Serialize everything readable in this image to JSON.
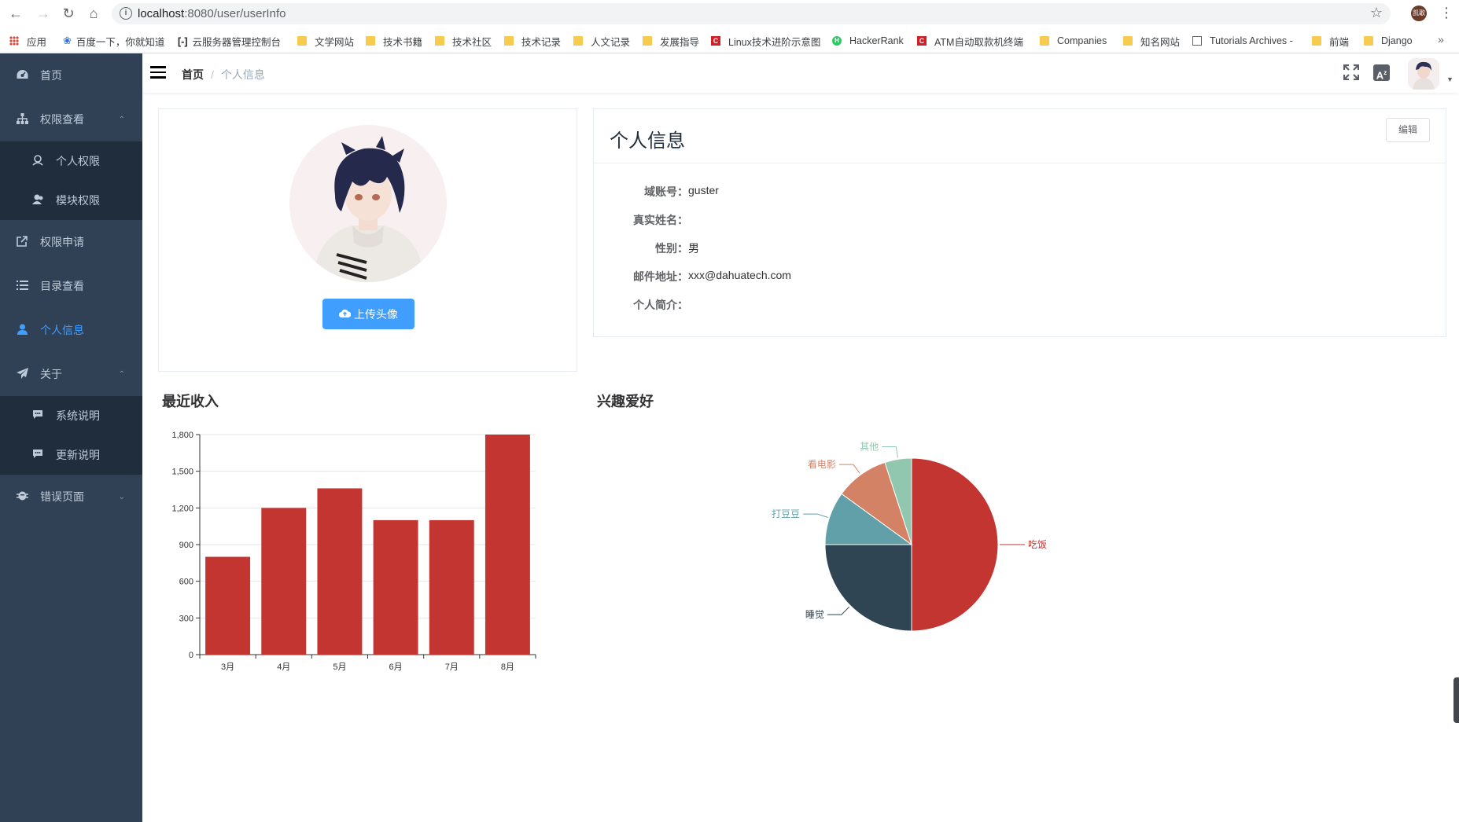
{
  "browser": {
    "url_host": "localhost",
    "url_path": ":8080/user/userInfo",
    "profile_label": "凯歌",
    "bookmarks": [
      {
        "label": "应用",
        "icon": "apps-grid-icon"
      },
      {
        "label": "百度一下，你就知道",
        "icon": "baidu-paw-icon"
      },
      {
        "label": "云服务器管理控制台",
        "icon": "aliyun-icon"
      },
      {
        "label": "文学网站",
        "icon": "folder-icon"
      },
      {
        "label": "技术书籍",
        "icon": "folder-icon"
      },
      {
        "label": "技术社区",
        "icon": "folder-icon"
      },
      {
        "label": "技术记录",
        "icon": "folder-icon"
      },
      {
        "label": "人文记录",
        "icon": "folder-icon"
      },
      {
        "label": "发展指导",
        "icon": "folder-icon"
      },
      {
        "label": "Linux技术进阶示意图",
        "icon": "csdn-icon"
      },
      {
        "label": "HackerRank",
        "icon": "hackerrank-icon"
      },
      {
        "label": "ATM自动取款机终端",
        "icon": "csdn-icon"
      },
      {
        "label": "Companies",
        "icon": "folder-icon"
      },
      {
        "label": "知名网站",
        "icon": "folder-icon"
      },
      {
        "label": "Tutorials Archives -",
        "icon": "page-icon"
      },
      {
        "label": "前端",
        "icon": "folder-icon"
      },
      {
        "label": "Django",
        "icon": "folder-icon"
      }
    ]
  },
  "sidebar": {
    "items": [
      {
        "label": "首页",
        "icon": "dashboard-icon"
      },
      {
        "label": "权限查看",
        "icon": "tree-icon"
      },
      {
        "label": "个人权限",
        "icon": "user-perm-icon"
      },
      {
        "label": "模块权限",
        "icon": "peoples-icon"
      },
      {
        "label": "权限申请",
        "icon": "external-link-icon"
      },
      {
        "label": "目录查看",
        "icon": "list-icon"
      },
      {
        "label": "个人信息",
        "icon": "user-icon"
      },
      {
        "label": "关于",
        "icon": "send-icon"
      },
      {
        "label": "系统说明",
        "icon": "message-icon"
      },
      {
        "label": "更新说明",
        "icon": "message-icon"
      },
      {
        "label": "错误页面",
        "icon": "bug-icon"
      }
    ],
    "active_color": "#409eff",
    "bg_color": "#304156"
  },
  "navbar": {
    "breadcrumb": [
      "首页",
      "个人信息"
    ],
    "lang_icon_label": "A"
  },
  "profile_card": {
    "upload_label": "上传头像"
  },
  "info_card": {
    "title": "个人信息",
    "edit_label": "编辑",
    "fields": [
      {
        "label": "域账号：",
        "value": "guster"
      },
      {
        "label": "真实姓名：",
        "value": ""
      },
      {
        "label": "性别：",
        "value": "男"
      },
      {
        "label": "邮件地址：",
        "value": "xxx@dahuatech.com"
      },
      {
        "label": "个人简介：",
        "value": ""
      }
    ]
  },
  "charts": {
    "income_title": "最近收入",
    "hobby_title": "兴趣爱好"
  },
  "chart_data": [
    {
      "type": "bar",
      "title": "最近收入",
      "categories": [
        "3月",
        "4月",
        "5月",
        "6月",
        "7月",
        "8月"
      ],
      "values": [
        800,
        1200,
        1360,
        1100,
        1100,
        1800
      ],
      "ylim": [
        0,
        1800
      ],
      "yticks": [
        "0",
        "300",
        "600",
        "900",
        "1,200",
        "1,500",
        "1,800"
      ],
      "color": "#c23531",
      "grid": true
    },
    {
      "type": "pie",
      "title": "兴趣爱好",
      "slices": [
        {
          "name": "吃饭",
          "value": 50,
          "color": "#c23531"
        },
        {
          "name": "睡觉",
          "value": 25,
          "color": "#2f4554"
        },
        {
          "name": "打豆豆",
          "value": 10,
          "color": "#61a0a8"
        },
        {
          "name": "看电影",
          "value": 10,
          "color": "#d48265"
        },
        {
          "name": "其他",
          "value": 5,
          "color": "#91c7ae"
        }
      ]
    }
  ]
}
